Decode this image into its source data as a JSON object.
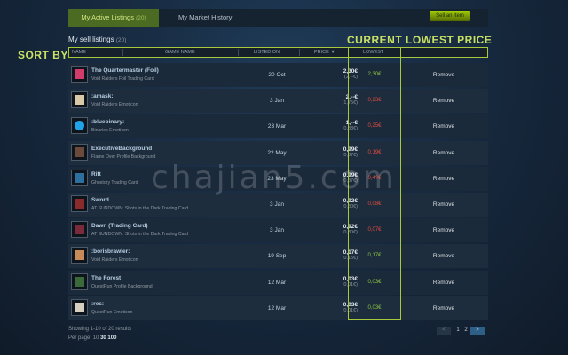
{
  "tabs": {
    "active": {
      "label": "My Active Listings",
      "count": "(20)"
    },
    "history": {
      "label": "My Market History"
    }
  },
  "sell_button": "Sell an Item",
  "listings_title": {
    "label": "My sell listings",
    "count": "(20)"
  },
  "annotations": {
    "sort_by": "SORT BY",
    "lowest_price": "CURRENT LOWEST PRICE"
  },
  "columns": {
    "name": "NAME",
    "game_name": "GAME NAME",
    "listed_on": "LISTED ON",
    "price": "PRICE ▼",
    "lowest": "LOWEST"
  },
  "colors": {
    "accent": "#a7c93b",
    "lowest_green": "#8bc53f",
    "lowest_red": "#e04a3e"
  },
  "rows": [
    {
      "name": "The Quartermaster (Foil)",
      "game": "Void Raiders Foil Trading Card",
      "date": "20 Oct",
      "price_buyer": "2,30€",
      "price_you": "(2,--€)",
      "lowest": "2,30€",
      "lowest_status": "green",
      "remove": "Remove",
      "thumb_color": "#d23c6a"
    },
    {
      "name": ":amask:",
      "game": "Void Raiders Emoticon",
      "date": "3 Jan",
      "price_buyer": "2,--€",
      "price_you": "(1,75€)",
      "lowest": "0,23€",
      "lowest_status": "red",
      "remove": "Remove",
      "thumb_color": "#d9c9a4"
    },
    {
      "name": ":bluebinary:",
      "game": "Binaries Emoticon",
      "date": "23 Mar",
      "price_buyer": "1,--€",
      "price_you": "(0,88€)",
      "lowest": "0,25€",
      "lowest_status": "red",
      "remove": "Remove",
      "thumb_color": "#1fa2e8"
    },
    {
      "name": "ExecutiveBackground",
      "game": "Flame Over Profile Background",
      "date": "22 May",
      "price_buyer": "0,99€",
      "price_you": "(0,87€)",
      "lowest": "0,19€",
      "lowest_status": "red",
      "remove": "Remove",
      "thumb_color": "#6a4a3a"
    },
    {
      "name": "Rift",
      "game": "Ghostory Trading Card",
      "date": "23 May",
      "price_buyer": "0,99€",
      "price_you": "(0,87€)",
      "lowest": "0,4?€",
      "lowest_status": "red",
      "remove": "Remove",
      "thumb_color": "#2d6f9e"
    },
    {
      "name": "Sword",
      "game": "AT SUNDOWN: Shots in the Dark Trading Card",
      "date": "3 Jan",
      "price_buyer": "0,92€",
      "price_you": "(0,80€)",
      "lowest": "0,08€",
      "lowest_status": "red",
      "remove": "Remove",
      "thumb_color": "#8a2a2a"
    },
    {
      "name": "Dawn (Trading Card)",
      "game": "AT SUNDOWN: Shots in the Dark Trading Card",
      "date": "3 Jan",
      "price_buyer": "0,92€",
      "price_you": "(0,80€)",
      "lowest": "0,07€",
      "lowest_status": "red",
      "remove": "Remove",
      "thumb_color": "#7a2a3a"
    },
    {
      "name": ":borisbrawler:",
      "game": "Void Raiders Emoticon",
      "date": "19 Sep",
      "price_buyer": "0,17€",
      "price_you": "(0,15€)",
      "lowest": "0,17€",
      "lowest_status": "green",
      "remove": "Remove",
      "thumb_color": "#c98a5a"
    },
    {
      "name": "The Forest",
      "game": "QuestRun Profile Background",
      "date": "12 Mar",
      "price_buyer": "0,03€",
      "price_you": "(0,01€)",
      "lowest": "0,03€",
      "lowest_status": "green",
      "remove": "Remove",
      "thumb_color": "#3a6a3a"
    },
    {
      "name": ":res:",
      "game": "QuestRun Emoticon",
      "date": "12 Mar",
      "price_buyer": "0,03€",
      "price_you": "(0,01€)",
      "lowest": "0,03€",
      "lowest_status": "green",
      "remove": "Remove",
      "thumb_color": "#d6cfc0"
    }
  ],
  "footer": {
    "showing": "Showing 1-10 of 20 results",
    "per_page_label": "Per page:",
    "per_page_options": [
      "10",
      "30",
      "100"
    ]
  },
  "pagination": {
    "prev": "<",
    "page1": "1",
    "page2": "2",
    "next": ">"
  },
  "watermark": "chajian5.com"
}
